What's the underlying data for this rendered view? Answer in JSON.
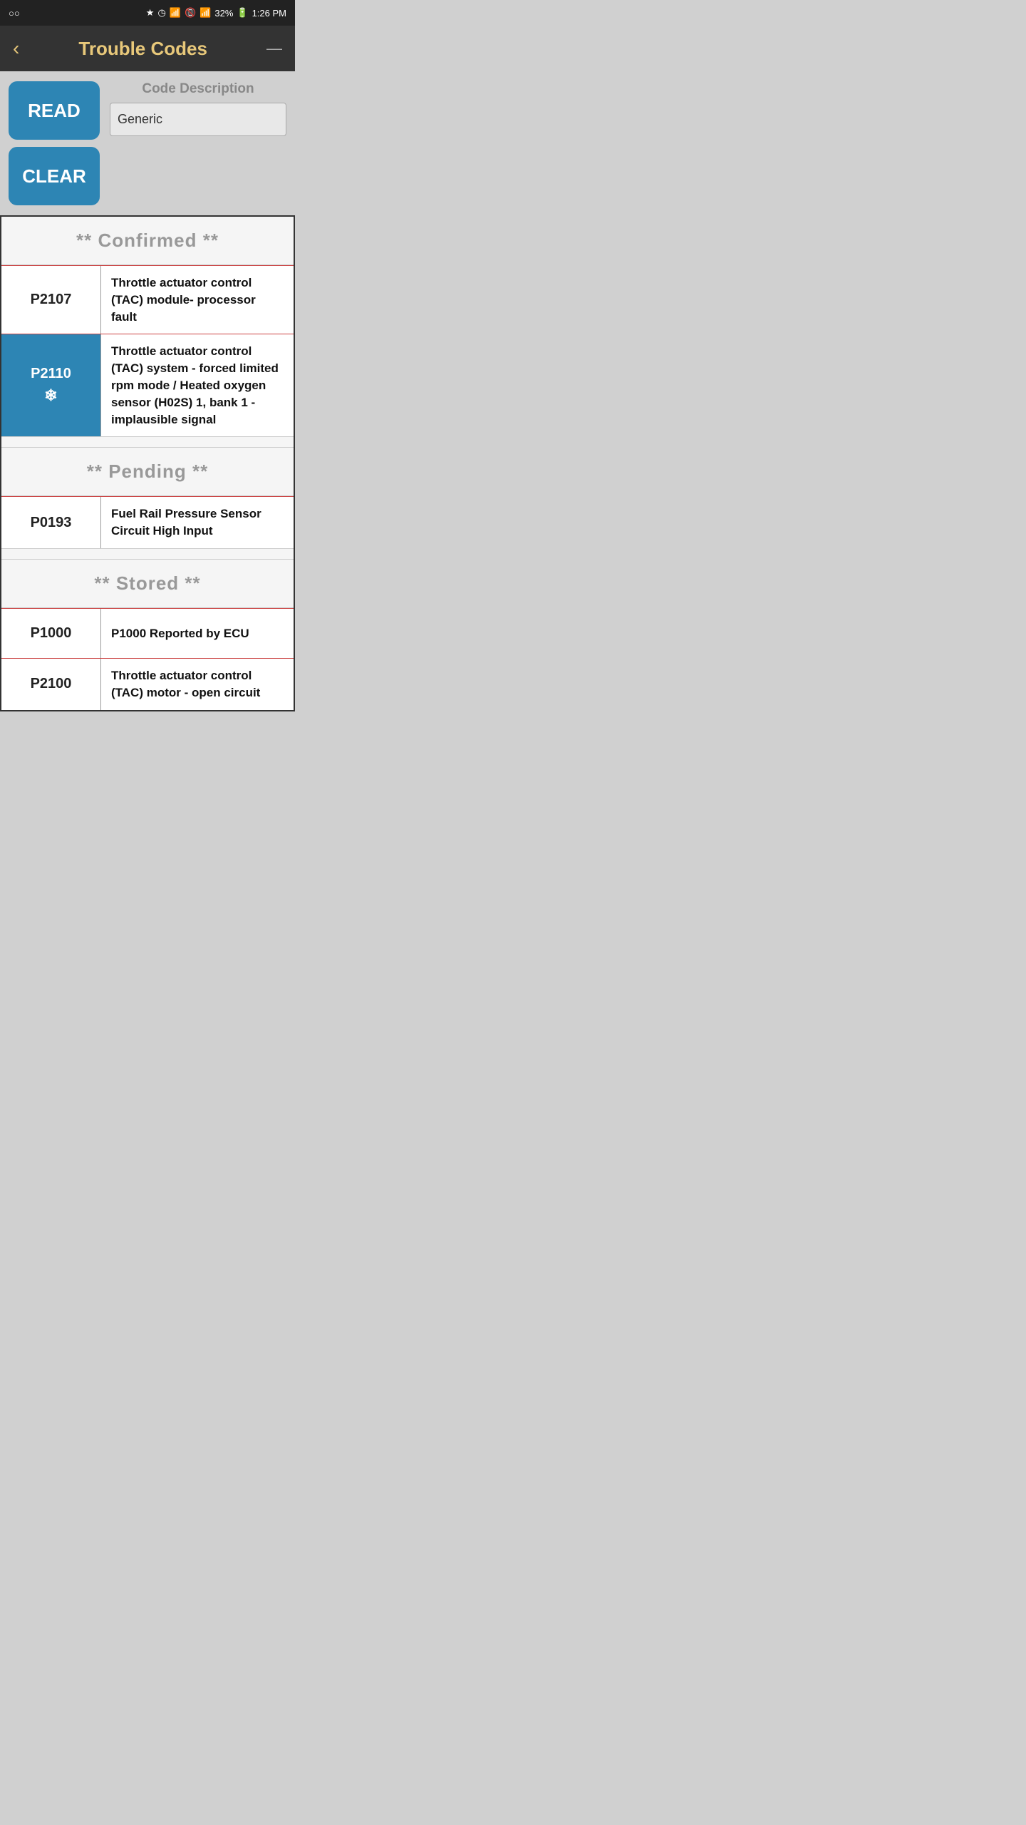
{
  "statusBar": {
    "leftIcon": "○○",
    "bluetooth": "bluetooth",
    "alarm": "alarm",
    "wifi": "wifi",
    "noSim": "no-sim",
    "signal": "signal",
    "battery": "32%",
    "time": "1:26 PM"
  },
  "header": {
    "backLabel": "‹",
    "title": "Trouble Codes",
    "minimizeLabel": "—"
  },
  "controls": {
    "readLabel": "READ",
    "clearLabel": "CLEAR",
    "codeDescLabel": "Code Description",
    "codeDescValue": "Generic",
    "codeDescPlaceholder": "Generic"
  },
  "sections": [
    {
      "title": "** Confirmed **",
      "rows": [
        {
          "code": "P2107",
          "description": "Throttle actuator control (TAC) module- processor fault",
          "highlighted": false
        },
        {
          "code": "P2110",
          "description": "Throttle actuator control (TAC) system - forced limited rpm mode / Heated oxygen sensor (H02S) 1, bank 1 - implausible signal",
          "highlighted": true
        }
      ]
    },
    {
      "title": "** Pending **",
      "rows": [
        {
          "code": "P0193",
          "description": "Fuel Rail Pressure Sensor Circuit High Input",
          "highlighted": false
        }
      ]
    },
    {
      "title": "** Stored **",
      "rows": [
        {
          "code": "P1000",
          "description": "P1000 Reported by ECU",
          "highlighted": false
        },
        {
          "code": "P2100",
          "description": "Throttle actuator control (TAC) motor - open circuit",
          "highlighted": false
        }
      ]
    }
  ]
}
